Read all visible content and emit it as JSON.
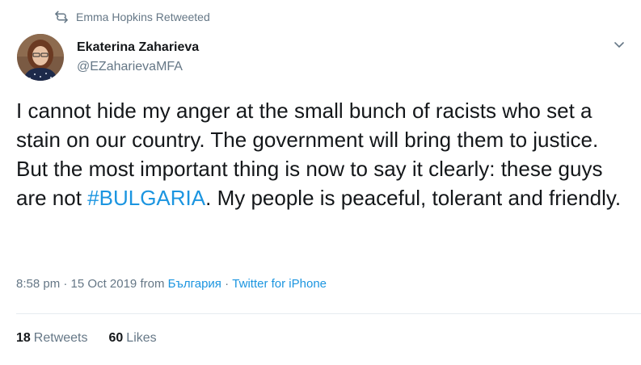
{
  "retweet_context": {
    "icon": "retweet-icon",
    "text": "Emma Hopkins Retweeted"
  },
  "author": {
    "display_name": "Ekaterina Zaharieva",
    "handle": "@EZaharievaMFA",
    "avatar_icon": "avatar"
  },
  "tweet": {
    "text_before": "I cannot hide my anger at the small bunch of racists who set a stain on our country. The government will bring them to justice. But the most important thing is now to say it clearly: these guys are not ",
    "hashtag": "#BULGARIA",
    "text_after": ". My people is peaceful, tolerant and friendly."
  },
  "meta": {
    "time": "8:58 pm",
    "separator1": " · ",
    "date": "15 Oct 2019",
    "from_label": " from ",
    "location": "България",
    "separator2": " · ",
    "source": "Twitter for iPhone"
  },
  "stats": {
    "retweets_count": "18",
    "retweets_label": "Retweets",
    "likes_count": "60",
    "likes_label": "Likes"
  },
  "colors": {
    "link": "#1b95e0",
    "secondary_text": "#657786",
    "primary_text": "#14171a",
    "divider": "#e6ecf0"
  }
}
